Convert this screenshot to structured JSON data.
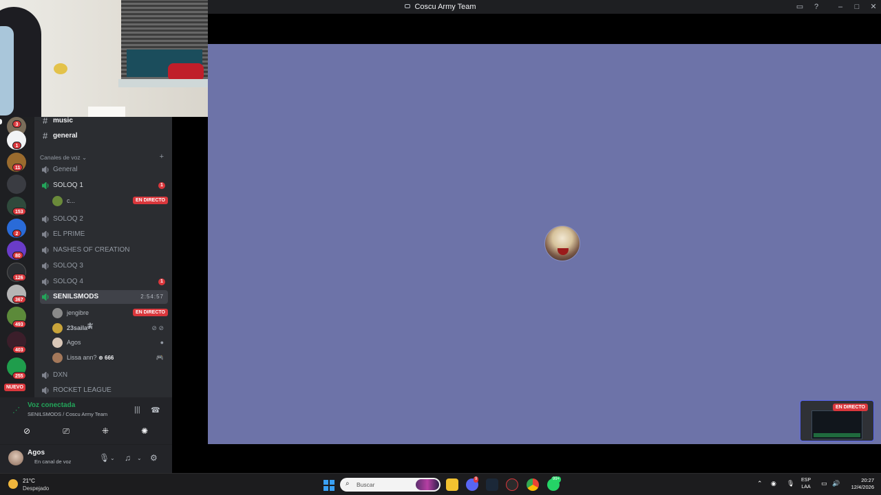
{
  "window": {
    "title": "Coscu Army Team",
    "minimize_icon": "minimize-icon",
    "maximize_icon": "maximize-icon",
    "close_icon": "close-icon"
  },
  "servers": {
    "badges": [
      "3",
      "1",
      "11",
      "153",
      "2",
      "80",
      "126",
      "367",
      "493",
      "403",
      "255"
    ],
    "nuevo_label": "NUEVO"
  },
  "channels": {
    "text": [
      {
        "label": "music"
      },
      {
        "label": "general"
      }
    ],
    "voice_header": "Canales de voz",
    "voice": [
      {
        "label": "General"
      },
      {
        "label": "SOLOQ 1",
        "mention": "1"
      },
      {
        "label": "SOLOQ 2"
      },
      {
        "label": "EL PRIME"
      },
      {
        "label": "NASHES OF CREATION"
      },
      {
        "label": "SOLOQ 3"
      },
      {
        "label": "SOLOQ 4",
        "mention": "1"
      },
      {
        "label": "SENILSMODS",
        "timer": "2:54:57"
      },
      {
        "label": "DXN"
      },
      {
        "label": "ROCKET LEAGUE"
      }
    ],
    "soloq1_user": {
      "name": "c...",
      "live": "EN DIRECTO"
    },
    "senils_users": [
      {
        "name": "jengibre",
        "live": "EN DIRECTO"
      },
      {
        "name": "23sailaༀ"
      },
      {
        "name": "Agos"
      },
      {
        "name": "Lissa ann?",
        "tag": "666"
      }
    ]
  },
  "voice_panel": {
    "status": "Voz conectada",
    "channel": "SENILSMODS / Coscu Army Team"
  },
  "user_panel": {
    "name": "Agos",
    "subtitle": "En canal de voz"
  },
  "stage": {
    "pip_live": "EN DIRECTO"
  },
  "taskbar": {
    "weather_temp": "21°C",
    "weather_cond": "Despejado",
    "search_placeholder": "Buscar",
    "discord_badge": "9",
    "whatsapp_badge": "99+",
    "lang_1": "ESP",
    "lang_2": "LAA",
    "time": "20:27",
    "date": "12/4/2026"
  },
  "colors": {
    "accent": "#5865f2",
    "live": "#da373c",
    "connected": "#23a55a",
    "stage_bg": "#6d73a8"
  }
}
